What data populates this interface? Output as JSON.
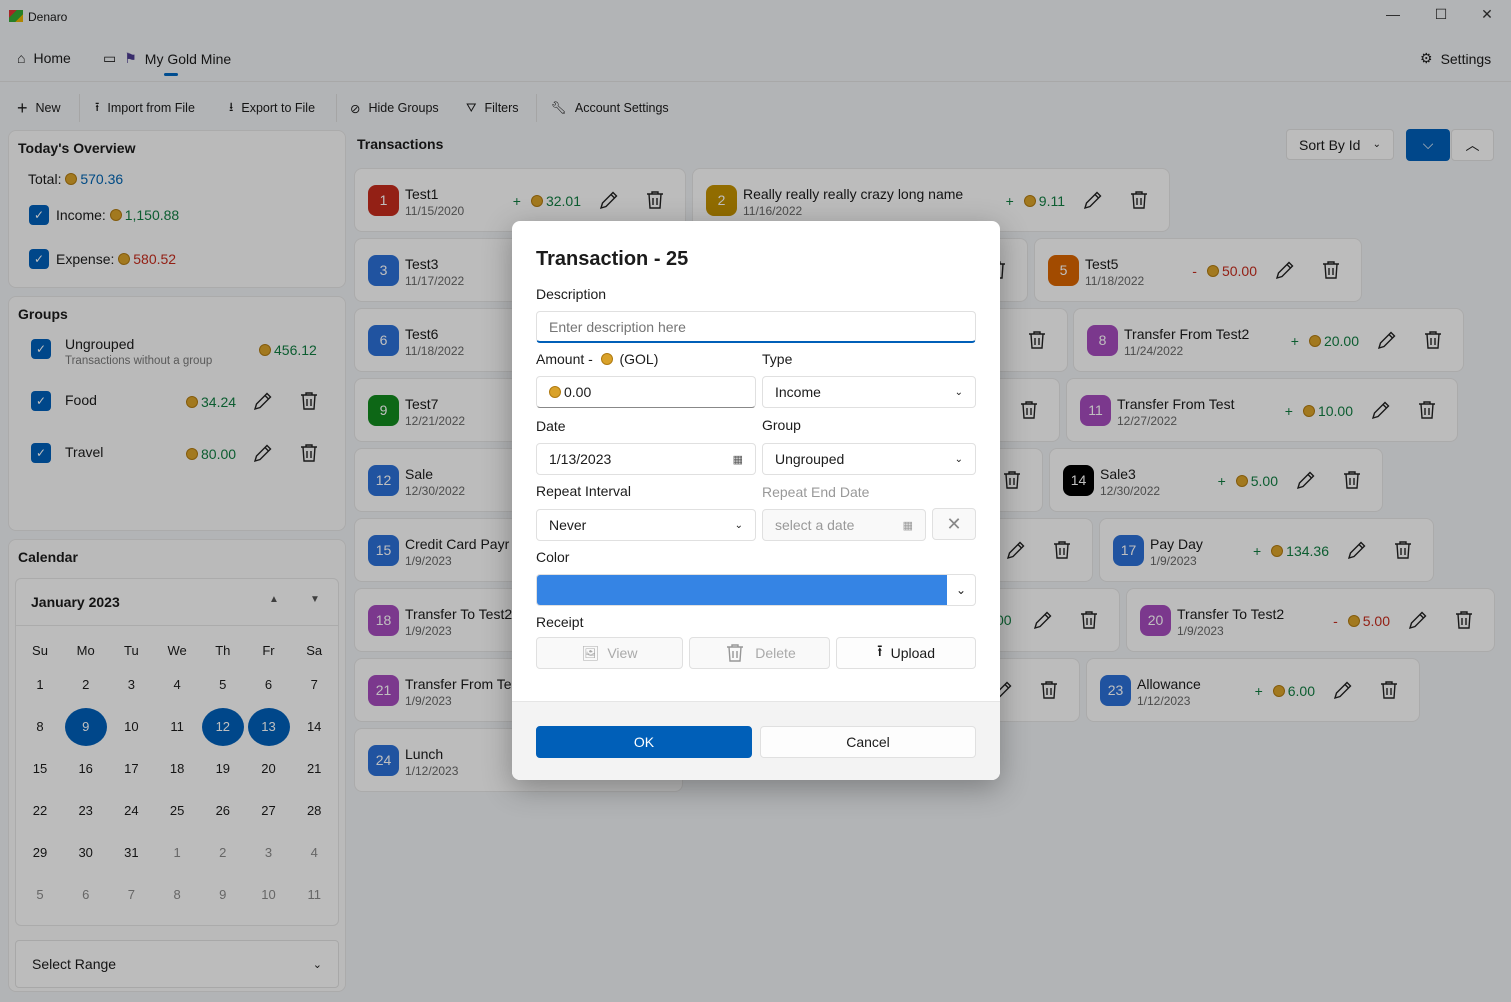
{
  "app": {
    "title": "Denaro"
  },
  "nav": {
    "home": "Home",
    "account": "My Gold Mine",
    "settings": "Settings"
  },
  "toolbar": {
    "new": "New",
    "import": "Import from File",
    "export": "Export to File",
    "hide_groups": "Hide Groups",
    "filters": "Filters",
    "account_settings": "Account Settings"
  },
  "overview": {
    "title": "Today's Overview",
    "total_label": "Total:",
    "total": "570.36",
    "income_label": "Income:",
    "income": "1,150.88",
    "expense_label": "Expense:",
    "expense": "580.52"
  },
  "groups": {
    "title": "Groups",
    "items": [
      {
        "name": "Ungrouped",
        "desc": "Transactions without a group",
        "amount": "456.12"
      },
      {
        "name": "Food",
        "amount": "34.24"
      },
      {
        "name": "Travel",
        "amount": "80.00"
      }
    ]
  },
  "calendar": {
    "title": "Calendar",
    "month": "January 2023",
    "weekdays": [
      "Su",
      "Mo",
      "Tu",
      "We",
      "Th",
      "Fr",
      "Sa"
    ],
    "days": [
      1,
      2,
      3,
      4,
      5,
      6,
      7,
      8,
      9,
      10,
      11,
      12,
      13,
      14,
      15,
      16,
      17,
      18,
      19,
      20,
      21,
      22,
      23,
      24,
      25,
      26,
      27,
      28,
      29,
      30,
      31,
      1,
      2,
      3,
      4,
      5,
      6,
      7,
      8,
      9,
      10,
      11
    ],
    "selected": [
      9,
      12,
      13
    ],
    "range_label": "Select Range"
  },
  "transactions": {
    "title": "Transactions",
    "sort": "Sort By Id",
    "cards": [
      {
        "id": "1",
        "name": "Test1",
        "date": "11/15/2020",
        "sign": "+",
        "amount": "32.01",
        "color": "#c42b1c",
        "type": "income"
      },
      {
        "id": "2",
        "name": "Really really really crazy long name",
        "date": "11/16/2022",
        "sign": "+",
        "amount": "9.11",
        "color": "#c29000",
        "type": "income"
      },
      {
        "id": "3",
        "name": "Test3",
        "date": "11/17/2022",
        "color": "#2b6fd6"
      },
      {
        "id": "5",
        "name": "Test5",
        "date": "11/18/2022",
        "sign": "-",
        "amount": "50.00",
        "color": "#d86400",
        "type": "expense"
      },
      {
        "id": "6",
        "name": "Test6",
        "date": "11/18/2022",
        "color": "#2b6fd6"
      },
      {
        "id": "8",
        "name": "Transfer From Test2",
        "date": "11/24/2022",
        "sign": "+",
        "amount": "20.00",
        "color": "#a54bbd",
        "type": "income"
      },
      {
        "id": "9",
        "name": "Test7",
        "date": "12/21/2022",
        "color": "#128a1e"
      },
      {
        "id": "11",
        "name": "Transfer From Test",
        "date": "12/27/2022",
        "sign": "+",
        "amount": "10.00",
        "color": "#a54bbd",
        "type": "income"
      },
      {
        "id": "12",
        "name": "Sale",
        "date": "12/30/2022",
        "color": "#2b6fd6"
      },
      {
        "id": "14",
        "name": "Sale3",
        "date": "12/30/2022",
        "sign": "+",
        "amount": "5.00",
        "color": "#000000",
        "type": "income"
      },
      {
        "id": "15",
        "name": "Credit Card Payr",
        "date": "1/9/2023",
        "color": "#2b6fd6"
      },
      {
        "id": "17",
        "name": "Pay Day",
        "date": "1/9/2023",
        "sign": "+",
        "amount": "134.36",
        "color": "#2b6fd6",
        "type": "income"
      },
      {
        "id": "18",
        "name": "Transfer To Test2",
        "date": "1/9/2023",
        "color": "#a54bbd"
      },
      {
        "id": "20",
        "name": "Transfer To Test2",
        "date": "1/9/2023",
        "sign": "-",
        "amount": "5.00",
        "color": "#a54bbd",
        "type": "expense"
      },
      {
        "id": "21",
        "name": "Transfer From Te",
        "date": "1/9/2023",
        "color": "#a54bbd"
      },
      {
        "id": "23",
        "name": "Allowance",
        "date": "1/12/2023",
        "sign": "+",
        "amount": "6.00",
        "color": "#2b6fd6",
        "type": "income"
      },
      {
        "id": "24",
        "name": "Lunch",
        "date": "1/12/2023",
        "color": "#2b6fd6"
      }
    ],
    "partial_amount_fragment": "00"
  },
  "dialog": {
    "title": "Transaction - 25",
    "description_label": "Description",
    "description_placeholder": "Enter description here",
    "amount_label": "Amount -",
    "currency": "(GOL)",
    "amount": "0.00",
    "type_label": "Type",
    "type": "Income",
    "date_label": "Date",
    "date": "1/13/2023",
    "group_label": "Group",
    "group": "Ungrouped",
    "repeat_label": "Repeat Interval",
    "repeat": "Never",
    "repeat_end_label": "Repeat End Date",
    "repeat_end_placeholder": "select a date",
    "color_label": "Color",
    "color": "#3584e4",
    "receipt_label": "Receipt",
    "view": "View",
    "delete": "Delete",
    "upload": "Upload",
    "ok": "OK",
    "cancel": "Cancel"
  },
  "colors": {
    "accent": "#005fb8",
    "income": "#107c41",
    "expense": "#c42b1c"
  }
}
